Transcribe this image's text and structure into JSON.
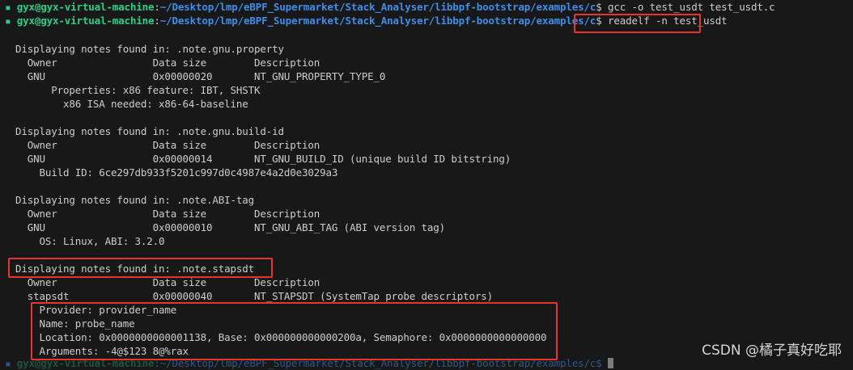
{
  "prompt": {
    "user": "gyx@gyx-virtual-machine",
    "path": "~/Desktop/lmp/eBPF_Supermarket/Stack_Analyser/libbpf-bootstrap/examples/c"
  },
  "commands": {
    "first": "gcc -o test_usdt test_usdt.c",
    "second": "readelf -n test_usdt"
  },
  "output": {
    "s1_head": "Displaying notes found in: .note.gnu.property",
    "s1_cols": "  Owner                Data size        Description",
    "s1_row": "  GNU                  0x00000020       NT_GNU_PROPERTY_TYPE_0",
    "s1_d1": "      Properties: x86 feature: IBT, SHSTK",
    "s1_d2": "        x86 ISA needed: x86-64-baseline",
    "s2_head": "Displaying notes found in: .note.gnu.build-id",
    "s2_cols": "  Owner                Data size        Description",
    "s2_row": "  GNU                  0x00000014       NT_GNU_BUILD_ID (unique build ID bitstring)",
    "s2_d1": "    Build ID: 6ce297db933f5201c997d0c4987e4a2d0e3029a3",
    "s3_head": "Displaying notes found in: .note.ABI-tag",
    "s3_cols": "  Owner                Data size        Description",
    "s3_row": "  GNU                  0x00000010       NT_GNU_ABI_TAG (ABI version tag)",
    "s3_d1": "    OS: Linux, ABI: 3.2.0",
    "s4_head": "Displaying notes found in: .note.stapsdt",
    "s4_cols": "  Owner                Data size        Description",
    "s4_row": "  stapsdt              0x00000040       NT_STAPSDT (SystemTap probe descriptors)",
    "s4_d1": "    Provider: provider_name",
    "s4_d2": "    Name: probe_name",
    "s4_d3": "    Location: 0x0000000000001138, Base: 0x000000000000200a, Semaphore: 0x0000000000000000",
    "s4_d4": "    Arguments: -4@$123 8@%rax"
  },
  "watermark": "CSDN @橘子真好吃耶",
  "colors": {
    "user": "#23d18b",
    "path": "#3b8eea",
    "highlight": "#e8352b",
    "background": "#181818"
  }
}
